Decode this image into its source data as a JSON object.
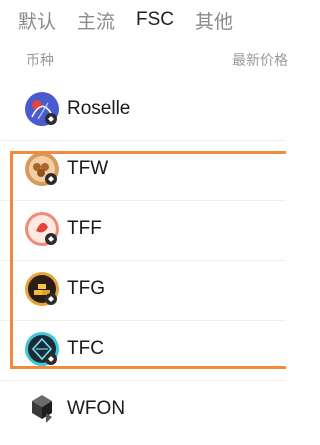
{
  "tabs": [
    "默认",
    "主流",
    "FSC",
    "其他"
  ],
  "active_tab": "FSC",
  "columns": {
    "left": "币种",
    "right": "最新价格"
  },
  "coins": [
    {
      "name": "Roselle",
      "icon": "roselle-icon"
    },
    {
      "name": "TFW",
      "icon": "tfw-icon"
    },
    {
      "name": "TFF",
      "icon": "tff-icon"
    },
    {
      "name": "TFG",
      "icon": "tfg-icon"
    },
    {
      "name": "TFC",
      "icon": "tfc-icon"
    },
    {
      "name": "WFON",
      "icon": "wfon-icon"
    }
  ],
  "colors": {
    "highlight": "#f28a3c",
    "active_tab": "#222222",
    "inactive_tab": "#8a8a8a"
  }
}
